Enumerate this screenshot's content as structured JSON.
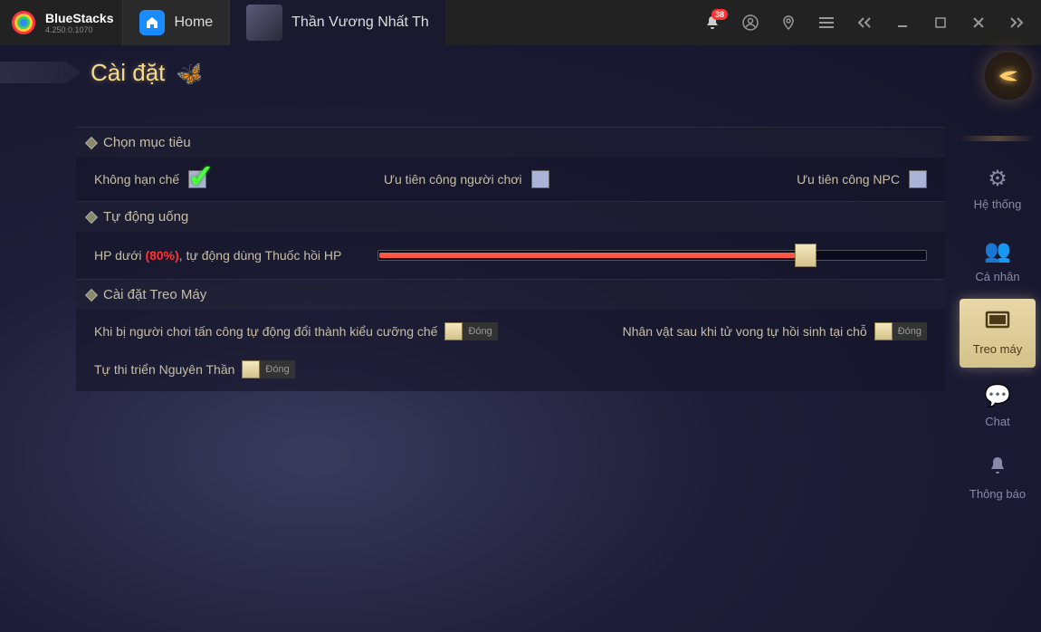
{
  "bluestacks": {
    "name": "BlueStacks",
    "version": "4.250.0.1070",
    "notification_count": "38"
  },
  "tabs": {
    "home": "Home",
    "game": "Thần Vương Nhất Th"
  },
  "settings": {
    "title": "Cài đặt"
  },
  "sections": {
    "target": {
      "header": "Chọn mục tiêu",
      "opt_unlimited": "Không hạn chế",
      "opt_pvp": "Ưu tiên công người chơi",
      "opt_npc": "Ưu tiên công NPC"
    },
    "auto_potion": {
      "header": "Tự động uống",
      "label_prefix": "HP dưới ",
      "label_pct": "(80%)",
      "label_suffix": ", tự động dùng Thuốc hồi HP",
      "slider_percent": 78
    },
    "afk": {
      "header": "Cài đặt Treo Máy",
      "opt_forced": "Khi bị người chơi tấn công tự động đổi thành kiểu cưỡng chế",
      "opt_revive": "Nhân vật sau khi tử vong tự hồi sinh tại chỗ",
      "opt_nguyenthan": "Tự thi triển Nguyên Thần",
      "state_label": "Đóng"
    }
  },
  "sidebar": {
    "system": "Hệ thống",
    "personal": "Cá nhân",
    "afk": "Treo máy",
    "chat": "Chat",
    "notify": "Thông báo"
  }
}
